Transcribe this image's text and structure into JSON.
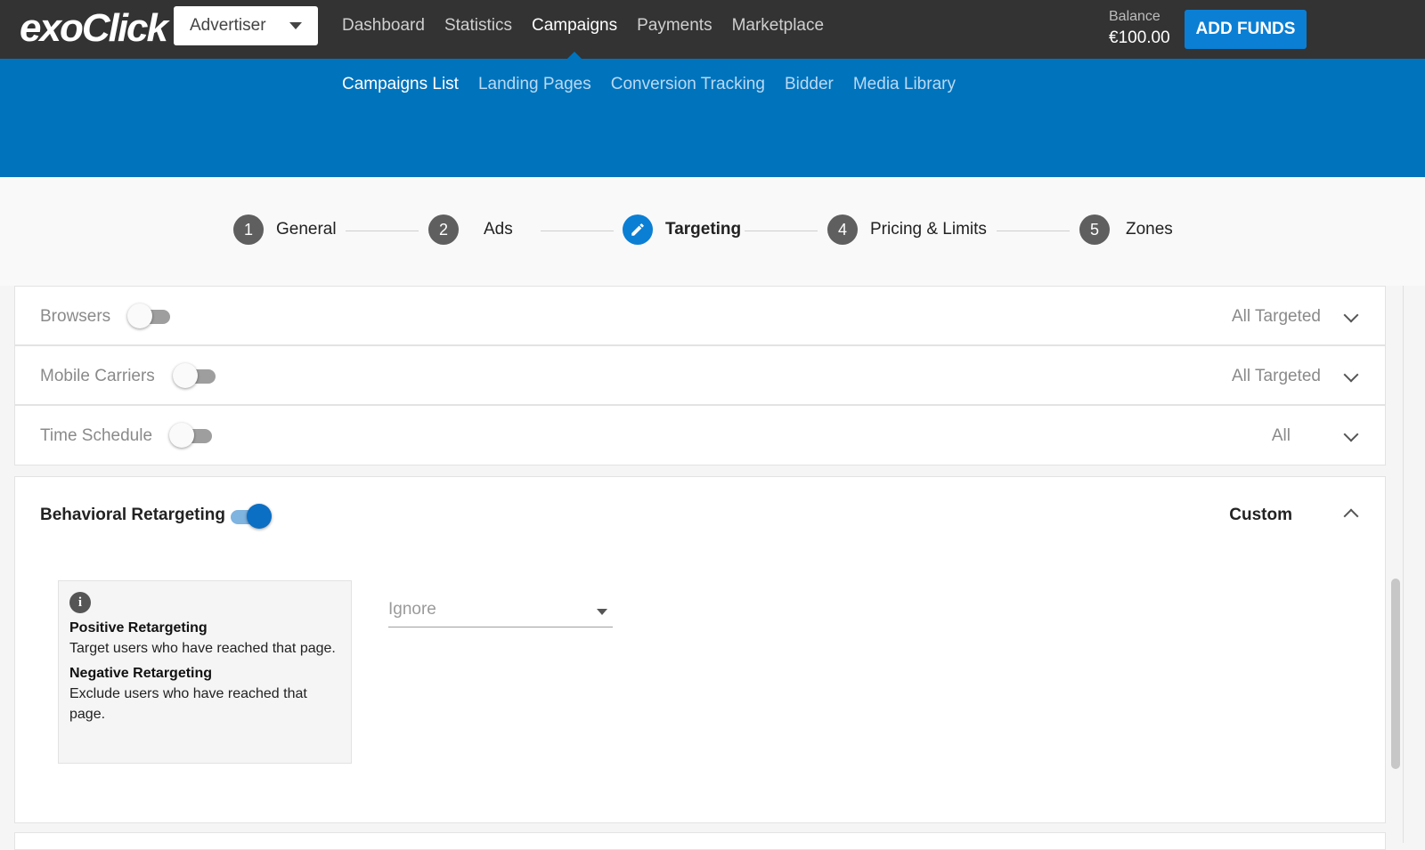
{
  "header": {
    "logo": "exoClick",
    "role": "Advertiser",
    "nav": [
      "Dashboard",
      "Statistics",
      "Campaigns",
      "Payments",
      "Marketplace"
    ],
    "active_nav": "Campaigns",
    "balance_label": "Balance",
    "balance_value": "€100.00",
    "add_funds": "ADD FUNDS"
  },
  "subnav": {
    "items": [
      "Campaigns List",
      "Landing Pages",
      "Conversion Tracking",
      "Bidder",
      "Media Library"
    ],
    "active": "Campaigns List"
  },
  "stepper": {
    "steps": [
      {
        "num": "1",
        "label": "General"
      },
      {
        "num": "2",
        "label": "Ads"
      },
      {
        "num": "",
        "label": "Targeting"
      },
      {
        "num": "4",
        "label": "Pricing & Limits"
      },
      {
        "num": "5",
        "label": "Zones"
      }
    ],
    "current": "Targeting"
  },
  "targeting": {
    "rows": [
      {
        "title": "Browsers",
        "value": "All Targeted",
        "enabled": false
      },
      {
        "title": "Mobile Carriers",
        "value": "All Targeted",
        "enabled": false
      },
      {
        "title": "Time Schedule",
        "value": "All",
        "enabled": false
      }
    ],
    "behavioral": {
      "title": "Behavioral Retargeting",
      "value": "Custom",
      "enabled": true,
      "info": {
        "positive_title": "Positive Retargeting",
        "positive_text": "Target users who have reached that page.",
        "negative_title": "Negative Retargeting",
        "negative_text": "Exclude users who have reached that page."
      },
      "select_value": "Ignore"
    }
  },
  "colors": {
    "topbar": "#333333",
    "brand_blue": "#0073bd",
    "button_blue": "#0b7fd4"
  }
}
